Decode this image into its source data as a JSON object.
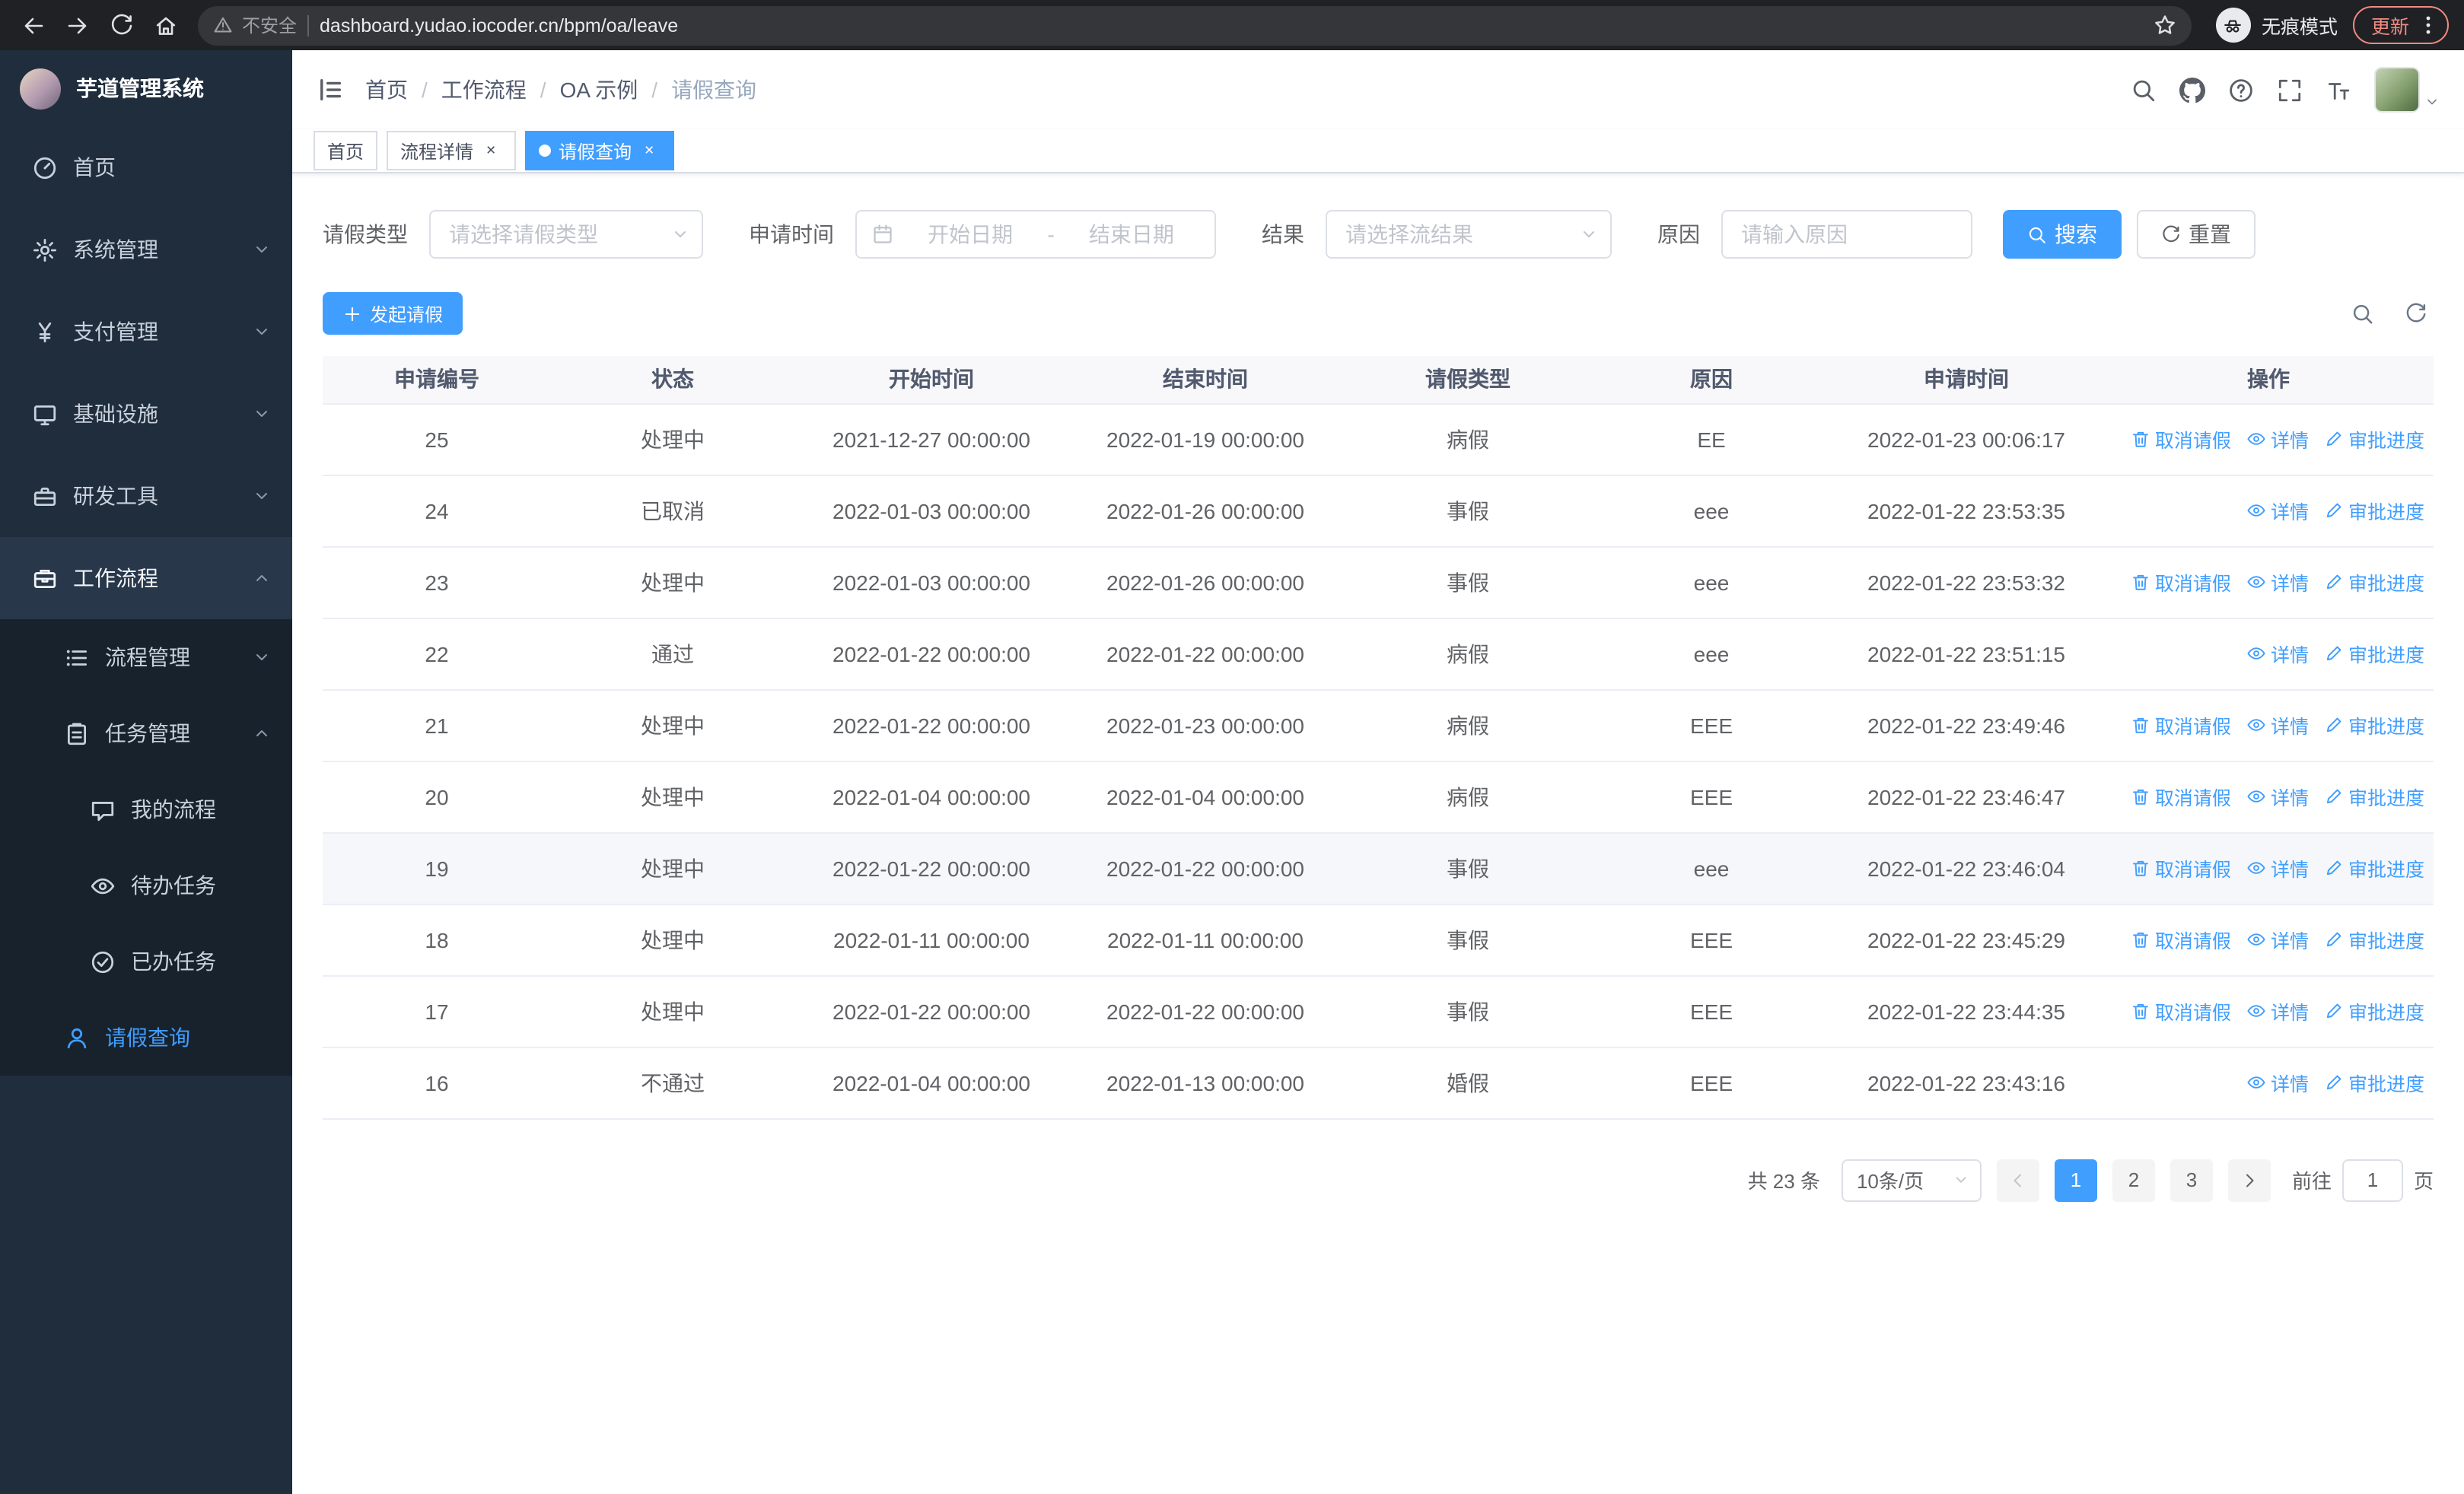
{
  "colors": {
    "accent": "#409eff",
    "sidebar_bg": "#1f2d3d",
    "update_chip": "#f28b82",
    "tab_active": "#409eff"
  },
  "browser": {
    "security_label": "不安全",
    "url": "dashboard.yudao.iocoder.cn/bpm/oa/leave",
    "incognito_label": "无痕模式",
    "update_label": "更新"
  },
  "sidebar": {
    "logo_title": "芋道管理系统",
    "items": [
      {
        "label": "首页"
      },
      {
        "label": "系统管理"
      },
      {
        "label": "支付管理"
      },
      {
        "label": "基础设施"
      },
      {
        "label": "研发工具"
      },
      {
        "label": "工作流程"
      },
      {
        "label": "流程管理"
      },
      {
        "label": "任务管理"
      },
      {
        "label": "我的流程"
      },
      {
        "label": "待办任务"
      },
      {
        "label": "已办任务"
      },
      {
        "label": "请假查询"
      }
    ]
  },
  "navbar": {
    "breadcrumb": [
      "首页",
      "工作流程",
      "OA 示例",
      "请假查询"
    ]
  },
  "tabs": [
    {
      "label": "首页"
    },
    {
      "label": "流程详情"
    },
    {
      "label": "请假查询"
    }
  ],
  "filters": {
    "leave_type_label": "请假类型",
    "leave_type_placeholder": "请选择请假类型",
    "apply_time_label": "申请时间",
    "start_date_placeholder": "开始日期",
    "range_separator": "-",
    "end_date_placeholder": "结束日期",
    "result_label": "结果",
    "result_placeholder": "请选择流结果",
    "reason_label": "原因",
    "reason_placeholder": "请输入原因",
    "search_button": "搜索",
    "reset_button": "重置"
  },
  "toolbar": {
    "create_button": "发起请假"
  },
  "table": {
    "columns": [
      "申请编号",
      "状态",
      "开始时间",
      "结束时间",
      "请假类型",
      "原因",
      "申请时间",
      "操作"
    ],
    "action_labels": {
      "cancel": "取消请假",
      "detail": "详情",
      "progress": "审批进度"
    },
    "rows": [
      {
        "id": "25",
        "status": "处理中",
        "start": "2021-12-27 00:00:00",
        "end": "2022-01-19 00:00:00",
        "type": "病假",
        "reason": "EE",
        "applied": "2022-01-23 00:06:17",
        "actions": [
          "cancel",
          "detail",
          "progress"
        ]
      },
      {
        "id": "24",
        "status": "已取消",
        "start": "2022-01-03 00:00:00",
        "end": "2022-01-26 00:00:00",
        "type": "事假",
        "reason": "eee",
        "applied": "2022-01-22 23:53:35",
        "actions": [
          "detail",
          "progress"
        ]
      },
      {
        "id": "23",
        "status": "处理中",
        "start": "2022-01-03 00:00:00",
        "end": "2022-01-26 00:00:00",
        "type": "事假",
        "reason": "eee",
        "applied": "2022-01-22 23:53:32",
        "actions": [
          "cancel",
          "detail",
          "progress"
        ]
      },
      {
        "id": "22",
        "status": "通过",
        "start": "2022-01-22 00:00:00",
        "end": "2022-01-22 00:00:00",
        "type": "病假",
        "reason": "eee",
        "applied": "2022-01-22 23:51:15",
        "actions": [
          "detail",
          "progress"
        ]
      },
      {
        "id": "21",
        "status": "处理中",
        "start": "2022-01-22 00:00:00",
        "end": "2022-01-23 00:00:00",
        "type": "病假",
        "reason": "EEE",
        "applied": "2022-01-22 23:49:46",
        "actions": [
          "cancel",
          "detail",
          "progress"
        ]
      },
      {
        "id": "20",
        "status": "处理中",
        "start": "2022-01-04 00:00:00",
        "end": "2022-01-04 00:00:00",
        "type": "病假",
        "reason": "EEE",
        "applied": "2022-01-22 23:46:47",
        "actions": [
          "cancel",
          "detail",
          "progress"
        ]
      },
      {
        "id": "19",
        "status": "处理中",
        "start": "2022-01-22 00:00:00",
        "end": "2022-01-22 00:00:00",
        "type": "事假",
        "reason": "eee",
        "applied": "2022-01-22 23:46:04",
        "actions": [
          "cancel",
          "detail",
          "progress"
        ],
        "highlighted": true
      },
      {
        "id": "18",
        "status": "处理中",
        "start": "2022-01-11 00:00:00",
        "end": "2022-01-11 00:00:00",
        "type": "事假",
        "reason": "EEE",
        "applied": "2022-01-22 23:45:29",
        "actions": [
          "cancel",
          "detail",
          "progress"
        ]
      },
      {
        "id": "17",
        "status": "处理中",
        "start": "2022-01-22 00:00:00",
        "end": "2022-01-22 00:00:00",
        "type": "事假",
        "reason": "EEE",
        "applied": "2022-01-22 23:44:35",
        "actions": [
          "cancel",
          "detail",
          "progress"
        ]
      },
      {
        "id": "16",
        "status": "不通过",
        "start": "2022-01-04 00:00:00",
        "end": "2022-01-13 00:00:00",
        "type": "婚假",
        "reason": "EEE",
        "applied": "2022-01-22 23:43:16",
        "actions": [
          "detail",
          "progress"
        ]
      }
    ]
  },
  "pagination": {
    "total_text": "共 23 条",
    "page_size": "10条/页",
    "pages": [
      "1",
      "2",
      "3"
    ],
    "active_page": "1",
    "goto_label": "前往",
    "goto_value": "1",
    "page_unit": "页"
  }
}
